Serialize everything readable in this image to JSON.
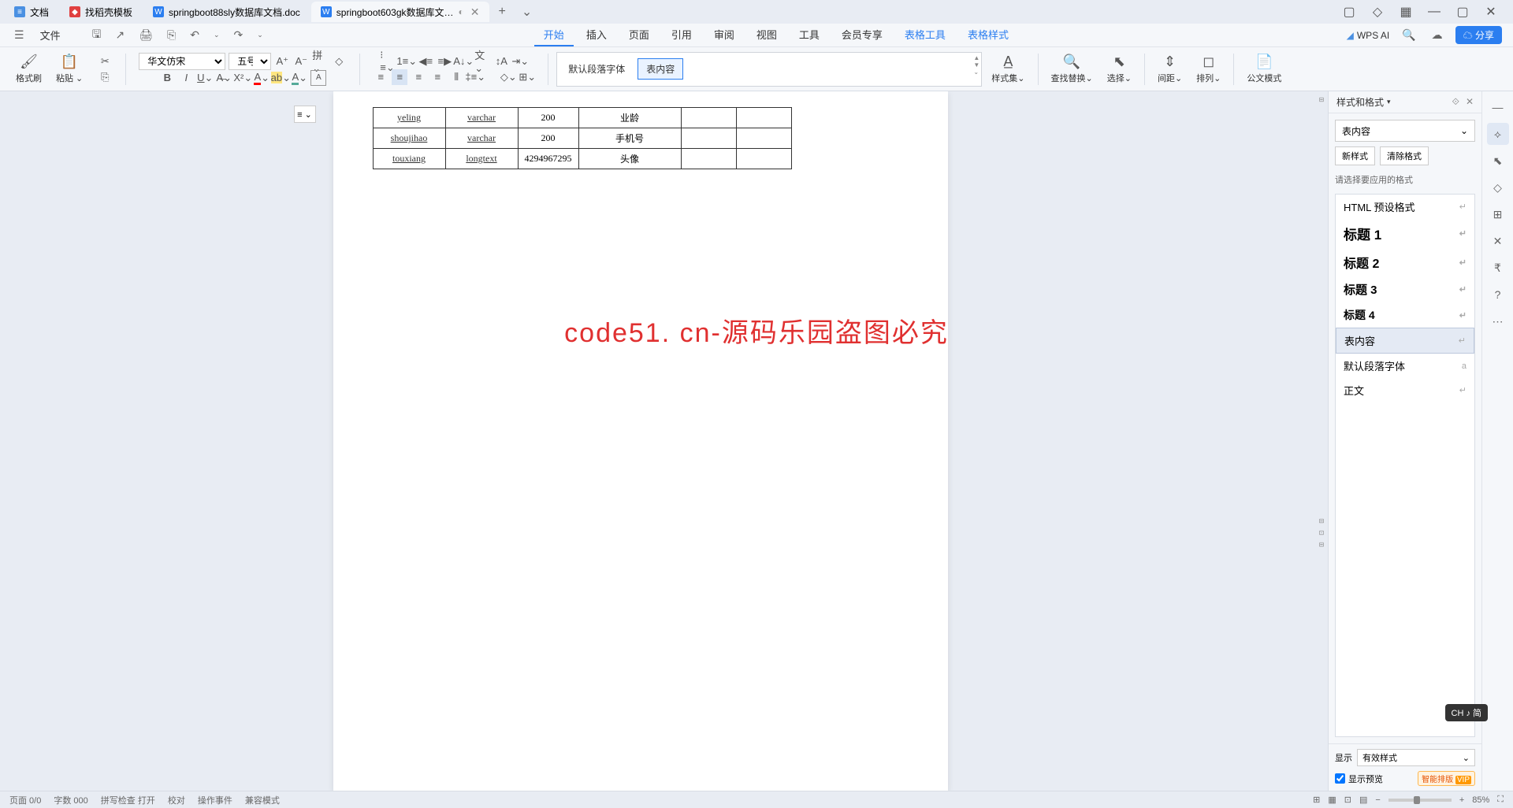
{
  "tabs": [
    {
      "icon_bg": "#4a90e2",
      "icon_txt": "≡",
      "label": "文档"
    },
    {
      "icon_bg": "#e04040",
      "icon_txt": "◆",
      "label": "找稻壳模板"
    },
    {
      "icon_bg": "#2b7ef0",
      "icon_txt": "W",
      "label": "springboot88sly数据库文档.doc"
    },
    {
      "icon_bg": "#2b7ef0",
      "icon_txt": "W",
      "label": "springboot603gk数据库文…",
      "active": true,
      "closable": true
    }
  ],
  "tab_add": "+",
  "tab_dropdown": "⌄",
  "win_icons": [
    "▢",
    "◇",
    "▦",
    "—",
    "▢",
    "✕"
  ],
  "filebar": {
    "menu_icon": "☰",
    "file_label": "文件",
    "quick": [
      "🖫",
      "↩",
      "🖨",
      "⎘"
    ],
    "undo": "↶",
    "redo": "↷"
  },
  "menu_tabs": [
    {
      "t": "开始",
      "active": true
    },
    {
      "t": "插入"
    },
    {
      "t": "页面"
    },
    {
      "t": "引用"
    },
    {
      "t": "审阅"
    },
    {
      "t": "视图"
    },
    {
      "t": "工具"
    },
    {
      "t": "会员专享"
    },
    {
      "t": "表格工具",
      "blue": true
    },
    {
      "t": "表格样式",
      "blue": true
    }
  ],
  "wps_ai": "WPS AI",
  "cloud_icon": "☁",
  "share": "分享",
  "ribbon": {
    "format_brush": "格式刷",
    "paste": "粘贴",
    "font_name": "华文仿宋",
    "font_size": "五号",
    "style_default": "默认段落字体",
    "style_selected": "表内容",
    "styleset": "样式集",
    "findreplace": "查找替换",
    "select": "选择",
    "spacing": "间距",
    "arrange": "排列",
    "govmode": "公文模式"
  },
  "table_rows": [
    {
      "c1": "yeling",
      "c2": "varchar",
      "c3": "200",
      "c4": "业龄"
    },
    {
      "c1": "shoujihao",
      "c2": "varchar",
      "c3": "200",
      "c4": "手机号"
    },
    {
      "c1": "touxiang",
      "c2": "longtext",
      "c3": "4294967295",
      "c4": "头像"
    }
  ],
  "watermark": "code51. cn-源码乐园盗图必究",
  "panel": {
    "title": "样式和格式",
    "current": "表内容",
    "new_style": "新样式",
    "clear_fmt": "清除格式",
    "hint": "请选择要应用的格式",
    "items": [
      {
        "t": "HTML 预设格式",
        "cls": ""
      },
      {
        "t": "标题 1",
        "cls": "h1"
      },
      {
        "t": "标题 2",
        "cls": "h2"
      },
      {
        "t": "标题 3",
        "cls": "h3"
      },
      {
        "t": "标题 4",
        "cls": "h4"
      },
      {
        "t": "表内容",
        "cls": "",
        "sel": true
      },
      {
        "t": "默认段落字体",
        "cls": "",
        "icon": "a"
      },
      {
        "t": "正文",
        "cls": ""
      }
    ],
    "show_label": "显示",
    "show_value": "有效样式",
    "preview_cb": "显示预览",
    "smart": "智能排版",
    "vip": "VIP"
  },
  "statusbar": {
    "items": [
      "页面 0/0",
      "字数 000",
      "拼写检查 打开",
      "校对",
      "操作事件",
      "兼容模式"
    ],
    "zoom": "85%"
  },
  "ime": "CH ♪ 简"
}
